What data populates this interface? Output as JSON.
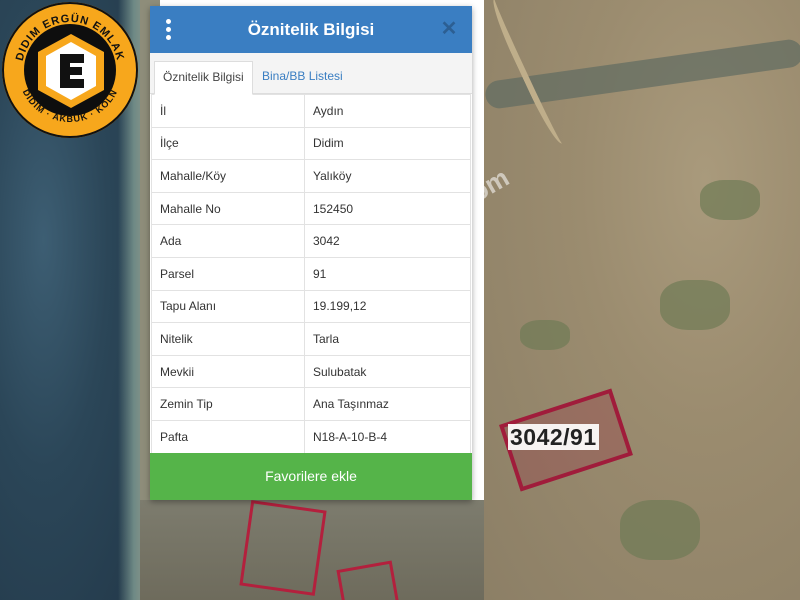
{
  "logo": {
    "top_text": "DIDIM ERGÜN EMLAK",
    "bottom_text": "DIDIM · AKBÜK · KÖLN",
    "letter": "E"
  },
  "panel": {
    "title": "Öznitelik Bilgisi",
    "tabs": [
      {
        "label": "Öznitelik Bilgisi",
        "active": true
      },
      {
        "label": "Bina/BB Listesi",
        "active": false
      }
    ],
    "rows": [
      {
        "key": "İl",
        "value": "Aydın"
      },
      {
        "key": "İlçe",
        "value": "Didim"
      },
      {
        "key": "Mahalle/Köy",
        "value": "Yalıköy"
      },
      {
        "key": "Mahalle No",
        "value": "152450"
      },
      {
        "key": "Ada",
        "value": "3042"
      },
      {
        "key": "Parsel",
        "value": "91"
      },
      {
        "key": "Tapu Alanı",
        "value": "19.199,12"
      },
      {
        "key": "Nitelik",
        "value": "Tarla"
      },
      {
        "key": "Mevkii",
        "value": "Sulubatak"
      },
      {
        "key": "Zemin Tip",
        "value": "Ana Taşınmaz"
      },
      {
        "key": "Pafta",
        "value": "N18-A-10-B-4"
      }
    ],
    "favorite_button": "Favorilere ekle",
    "close_icon": "close-icon",
    "menu_icon": "kebab-menu-icon"
  },
  "map": {
    "parcel_label": "3042/91",
    "watermark": "didimergunemlak.com",
    "colors": {
      "parcel_border": "#a01c3b",
      "header": "#3a7ec2",
      "button": "#55b449"
    }
  }
}
